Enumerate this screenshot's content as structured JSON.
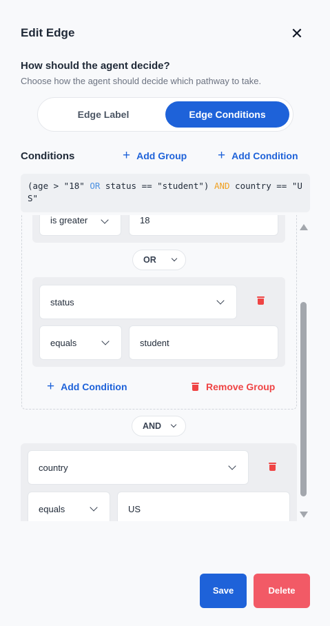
{
  "dialog": {
    "title": "Edit Edge",
    "close_icon": "close-icon"
  },
  "question": {
    "title": "How should the agent decide?",
    "subtitle": "Choose how the agent should decide which pathway to take."
  },
  "mode_toggle": {
    "options": [
      "Edge Label",
      "Edge Conditions"
    ],
    "selected": "Edge Conditions"
  },
  "conditions": {
    "title": "Conditions",
    "add_group_label": "Add Group",
    "add_condition_label": "Add Condition",
    "expression": {
      "part1": "(age > \"18\" ",
      "op1": "OR",
      "part2": " status == \"student\") ",
      "op2": "AND",
      "part3": " country == \"US\""
    },
    "group1": {
      "partial_row": {
        "operator": "is greater",
        "value": "18"
      },
      "joiner": "OR",
      "row2": {
        "field": "status",
        "operator": "equals",
        "value": "student"
      },
      "add_condition_label": "Add Condition",
      "remove_group_label": "Remove Group"
    },
    "group_joiner": "AND",
    "row3": {
      "field": "country",
      "operator": "equals",
      "value": "US"
    }
  },
  "footer": {
    "save_label": "Save",
    "delete_label": "Delete"
  },
  "colors": {
    "primary": "#1e62d9",
    "danger": "#ef4444",
    "delete_bg": "#f25a66",
    "or_keyword": "#4a90e2",
    "and_keyword": "#f0a020"
  }
}
